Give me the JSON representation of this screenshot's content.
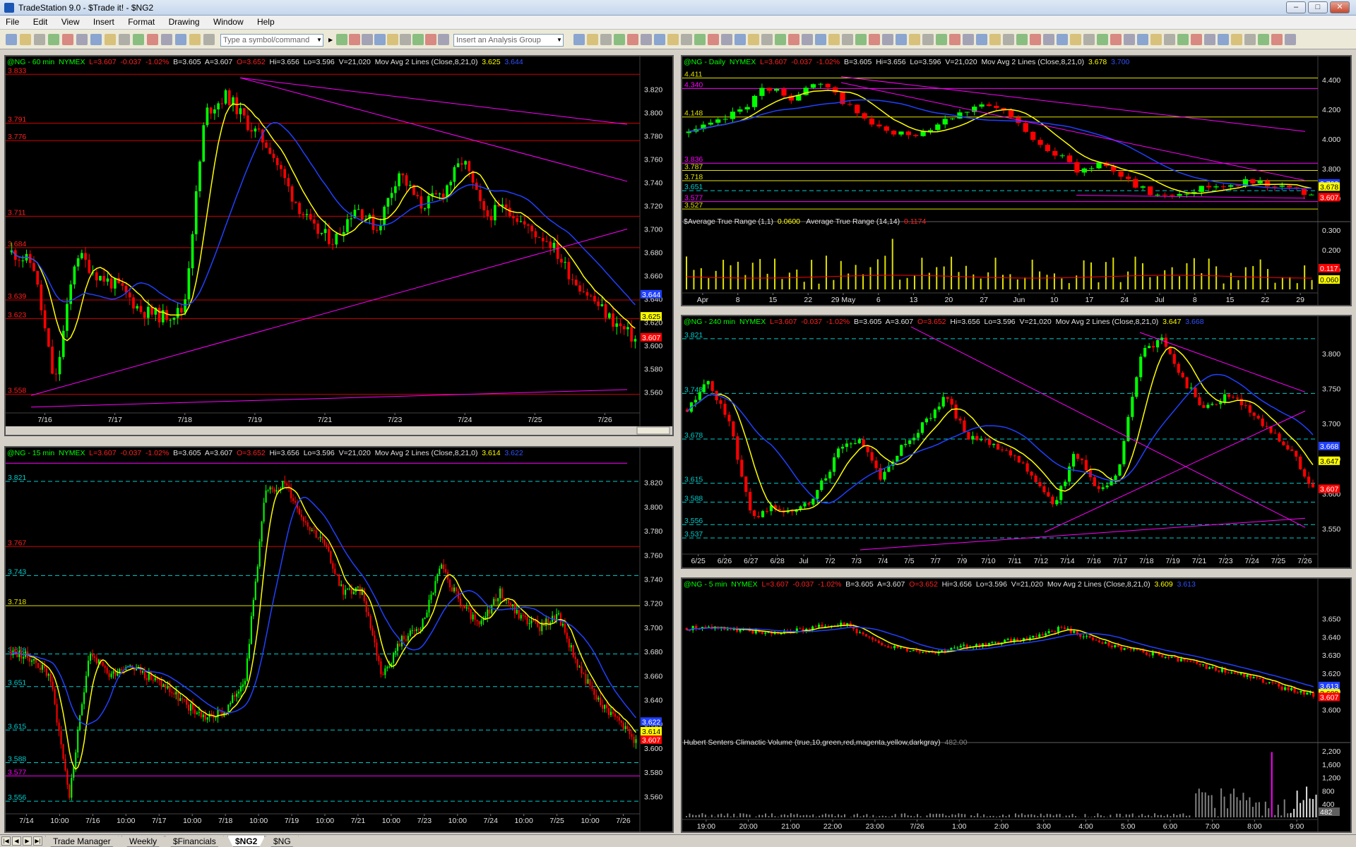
{
  "app": {
    "title": "TradeStation 9.0 - $Trade it! - $NG2"
  },
  "menu": [
    "File",
    "Edit",
    "View",
    "Insert",
    "Format",
    "Drawing",
    "Window",
    "Help"
  ],
  "toolbar": {
    "symbol_placeholder": "Type a symbol/command",
    "analysis_placeholder": "Insert an Analysis Group"
  },
  "colors": {
    "background": "#000000",
    "up_bar": "#00ff00",
    "down_bar": "#ff0000",
    "ma_fast": "#ffff00",
    "ma_slow": "#2040ff",
    "trendline": "#ff00ff",
    "level_red": "#d00000",
    "level_cyan": "#00cccc",
    "level_yellow": "#e0e000"
  },
  "panels": {
    "p60": {
      "sym": "@NG - 60 min",
      "exch": "NYMEX",
      "last": "L=3.607",
      "chg": "-0.037",
      "pct": "-1.02%",
      "bid": "B=3.605",
      "ask": "A=3.607",
      "open": "O=3.652",
      "hi": "Hi=3.656",
      "lo": "Lo=3.596",
      "vol": "V=21,020",
      "ind": "Mov Avg 2 Lines (Close,8,21,0)",
      "ma1": "3.625",
      "ma2": "3.644"
    },
    "p15": {
      "sym": "@NG - 15 min",
      "exch": "NYMEX",
      "last": "L=3.607",
      "chg": "-0.037",
      "pct": "-1.02%",
      "bid": "B=3.605",
      "ask": "A=3.607",
      "open": "O=3.652",
      "hi": "Hi=3.656",
      "lo": "Lo=3.596",
      "vol": "V=21,020",
      "ind": "Mov Avg 2 Lines (Close,8,21,0)",
      "ma1": "3.614",
      "ma2": "3.622"
    },
    "pD": {
      "sym": "@NG - Daily",
      "exch": "NYMEX",
      "last": "L=3.607",
      "chg": "-0.037",
      "pct": "-1.02%",
      "bid": "B=3.605",
      "ask": "",
      "open": "",
      "hi": "Hi=3.656",
      "lo": "Lo=3.596",
      "vol": "V=21,020",
      "ind": "Mov Avg 2 Lines (Close,8,21,0)",
      "ma1": "3.678",
      "ma2": "3.700",
      "sub": "$Average True Range (1,1)",
      "sub_v": "0.0600",
      "sub2": "Average True Range (14,14)",
      "sub2_v": "0.1174"
    },
    "p240": {
      "sym": "@NG - 240 min",
      "exch": "NYMEX",
      "last": "L=3.607",
      "chg": "-0.037",
      "pct": "-1.02%",
      "bid": "B=3.605",
      "ask": "A=3.607",
      "open": "O=3.652",
      "hi": "Hi=3.656",
      "lo": "Lo=3.596",
      "vol": "V=21,020",
      "ind": "Mov Avg 2 Lines (Close,8,21,0)",
      "ma1": "3.647",
      "ma2": "3.668"
    },
    "p5": {
      "sym": "@NG - 5 min",
      "exch": "NYMEX",
      "last": "L=3.607",
      "chg": "-0.037",
      "pct": "-1.02%",
      "bid": "B=3.605",
      "ask": "A=3.607",
      "open": "O=3.652",
      "hi": "Hi=3.656",
      "lo": "Lo=3.596",
      "vol": "V=21,020",
      "ind": "Mov Avg 2 Lines (Close,8,21,0)",
      "ma1": "3.609",
      "ma2": "3.613",
      "sub": "Hubert Senters Climactic Volume (true,10,green,red,magenta,yellow,darkgray)",
      "sub_v": "482.00"
    }
  },
  "chart_data": [
    {
      "name": "60 min",
      "type": "candlestick",
      "ylim": [
        3.545,
        3.835
      ],
      "yticks": [
        "3.820",
        "3.800",
        "3.780",
        "3.760",
        "3.740",
        "3.720",
        "3.700",
        "3.680",
        "3.660",
        "3.640",
        "3.620",
        "3.600",
        "3.580",
        "3.560"
      ],
      "xticks": [
        "7/16",
        "7/17",
        "7/18",
        "7/19",
        "7/21",
        "7/23",
        "7/24",
        "7/25",
        "7/26"
      ],
      "levels": [
        {
          "label": "3.833",
          "v": 3.833,
          "c": "red"
        },
        {
          "label": "3.791",
          "v": 3.791,
          "c": "red"
        },
        {
          "label": "3.776",
          "v": 3.776,
          "c": "red"
        },
        {
          "label": "3.711",
          "v": 3.711,
          "c": "red"
        },
        {
          "label": "3.684",
          "v": 3.684,
          "c": "red"
        },
        {
          "label": "3.639",
          "v": 3.639,
          "c": "red"
        },
        {
          "label": "3.623",
          "v": 3.623,
          "c": "red"
        },
        {
          "label": "3.558",
          "v": 3.558,
          "c": "red"
        }
      ],
      "tags": [
        {
          "t": "3.644",
          "c": "#2040ff",
          "v": 3.644
        },
        {
          "t": "3.625",
          "c": "#ffff00",
          "v": 3.625
        },
        {
          "t": "3.607",
          "c": "#ff0000",
          "v": 3.607
        }
      ]
    },
    {
      "name": "15 min",
      "type": "candlestick",
      "ylim": [
        3.545,
        3.835
      ],
      "yticks": [
        "3.820",
        "3.800",
        "3.780",
        "3.760",
        "3.740",
        "3.720",
        "3.700",
        "3.680",
        "3.660",
        "3.640",
        "3.620",
        "3.600",
        "3.580",
        "3.560"
      ],
      "xticks": [
        "7/14",
        "10:00",
        "7/16",
        "10:00",
        "7/17",
        "10:00",
        "7/18",
        "10:00",
        "7/19",
        "10:00",
        "7/21",
        "10:00",
        "7/23",
        "10:00",
        "7/24",
        "10:00",
        "7/25",
        "10:00",
        "7/26"
      ],
      "levels": [
        {
          "label": "3.821",
          "v": 3.821,
          "c": "cyan"
        },
        {
          "label": "3.767",
          "v": 3.767,
          "c": "red"
        },
        {
          "label": "3.743",
          "v": 3.743,
          "c": "cyan"
        },
        {
          "label": "3.718",
          "v": 3.718,
          "c": "yellow"
        },
        {
          "label": "3.678",
          "v": 3.678,
          "c": "cyan"
        },
        {
          "label": "3.651",
          "v": 3.651,
          "c": "cyan"
        },
        {
          "label": "3.615",
          "v": 3.615,
          "c": "cyan"
        },
        {
          "label": "3.588",
          "v": 3.588,
          "c": "cyan"
        },
        {
          "label": "3.577",
          "v": 3.577,
          "c": "magenta"
        },
        {
          "label": "3.556",
          "v": 3.556,
          "c": "cyan"
        }
      ],
      "tags": [
        {
          "t": "3.622",
          "c": "#2040ff",
          "v": 3.622
        },
        {
          "t": "3.614",
          "c": "#ffff00",
          "v": 3.614
        },
        {
          "t": "3.607",
          "c": "#ff0000",
          "v": 3.607
        }
      ]
    },
    {
      "name": "Daily",
      "type": "candlestick",
      "ylim": [
        3.48,
        4.48
      ],
      "yticks": [
        "4.400",
        "4.200",
        "4.000",
        "3.800",
        "3.600"
      ],
      "xticks": [
        "Apr",
        "8",
        "15",
        "22",
        "29 May",
        "6",
        "13",
        "20",
        "27",
        "Jun",
        "10",
        "17",
        "24",
        "Jul",
        "8",
        "15",
        "22",
        "29"
      ],
      "levels": [
        {
          "label": "4.411",
          "v": 4.411,
          "c": "yellow"
        },
        {
          "label": "4.340",
          "v": 4.34,
          "c": "magenta"
        },
        {
          "label": "4.148",
          "v": 4.148,
          "c": "yellow"
        },
        {
          "label": "3.836",
          "v": 3.836,
          "c": "magenta"
        },
        {
          "label": "3.787",
          "v": 3.787,
          "c": "yellow"
        },
        {
          "label": "3.718",
          "v": 3.718,
          "c": "yellow"
        },
        {
          "label": "3.651",
          "v": 3.651,
          "c": "cyan"
        },
        {
          "label": "3.577",
          "v": 3.577,
          "c": "magenta"
        },
        {
          "label": "3.527",
          "v": 3.527,
          "c": "yellow"
        }
      ],
      "tags": [
        {
          "t": "3.700",
          "c": "#2040ff",
          "v": 3.7
        },
        {
          "t": "3.678",
          "c": "#ffff00",
          "v": 3.678
        },
        {
          "t": "3.607",
          "c": "#ff0000",
          "v": 3.607
        }
      ],
      "sub_yticks": [
        "0.300",
        "0.200",
        "0.100"
      ],
      "sub_tags": [
        {
          "t": "0.117",
          "c": "#ff0000"
        },
        {
          "t": "0.060",
          "c": "#ffff00"
        }
      ]
    },
    {
      "name": "240 min",
      "type": "candlestick",
      "ylim": [
        3.525,
        3.835
      ],
      "yticks": [
        "3.800",
        "3.750",
        "3.700",
        "3.650",
        "3.600",
        "3.550"
      ],
      "xticks": [
        "6/25",
        "6/26",
        "6/27",
        "6/28",
        "Jul",
        "7/2",
        "7/3",
        "7/4",
        "7/5",
        "7/7",
        "7/9",
        "7/10",
        "7/11",
        "7/12",
        "7/14",
        "7/16",
        "7/17",
        "7/18",
        "7/19",
        "7/21",
        "7/23",
        "7/24",
        "7/25",
        "7/26"
      ],
      "levels": [
        {
          "label": "3.821",
          "v": 3.821,
          "c": "cyan"
        },
        {
          "label": "3.743",
          "v": 3.743,
          "c": "cyan"
        },
        {
          "label": "3.678",
          "v": 3.678,
          "c": "cyan"
        },
        {
          "label": "3.615",
          "v": 3.615,
          "c": "cyan"
        },
        {
          "label": "3.588",
          "v": 3.588,
          "c": "cyan"
        },
        {
          "label": "3.556",
          "v": 3.556,
          "c": "cyan"
        },
        {
          "label": "3.537",
          "v": 3.537,
          "c": "cyan"
        }
      ],
      "tags": [
        {
          "t": "3.668",
          "c": "#2040ff",
          "v": 3.668
        },
        {
          "t": "3.647",
          "c": "#ffff00",
          "v": 3.647
        },
        {
          "t": "3.607",
          "c": "#ff0000",
          "v": 3.607
        }
      ]
    },
    {
      "name": "5 min",
      "type": "candlestick",
      "ylim": [
        3.585,
        3.665
      ],
      "yticks": [
        "3.650",
        "3.640",
        "3.630",
        "3.620",
        "3.610",
        "3.600"
      ],
      "xticks": [
        "19:00",
        "20:00",
        "21:00",
        "22:00",
        "23:00",
        "7/26",
        "1:00",
        "2:00",
        "3:00",
        "4:00",
        "5:00",
        "6:00",
        "7:00",
        "8:00",
        "9:00"
      ],
      "tags": [
        {
          "t": "3.613",
          "c": "#2040ff",
          "v": 3.613
        },
        {
          "t": "3.609",
          "c": "#ffff00",
          "v": 3.609
        },
        {
          "t": "3.607",
          "c": "#ff0000",
          "v": 3.607
        }
      ],
      "sub_yticks": [
        "2,200",
        "1,600",
        "1,200",
        "800",
        "400"
      ],
      "sub_tag": "482"
    }
  ],
  "tabs": [
    "Trade Manager",
    "Weekly",
    "$Financials",
    "$NG2",
    "$NG"
  ],
  "active_tab": "$NG2"
}
